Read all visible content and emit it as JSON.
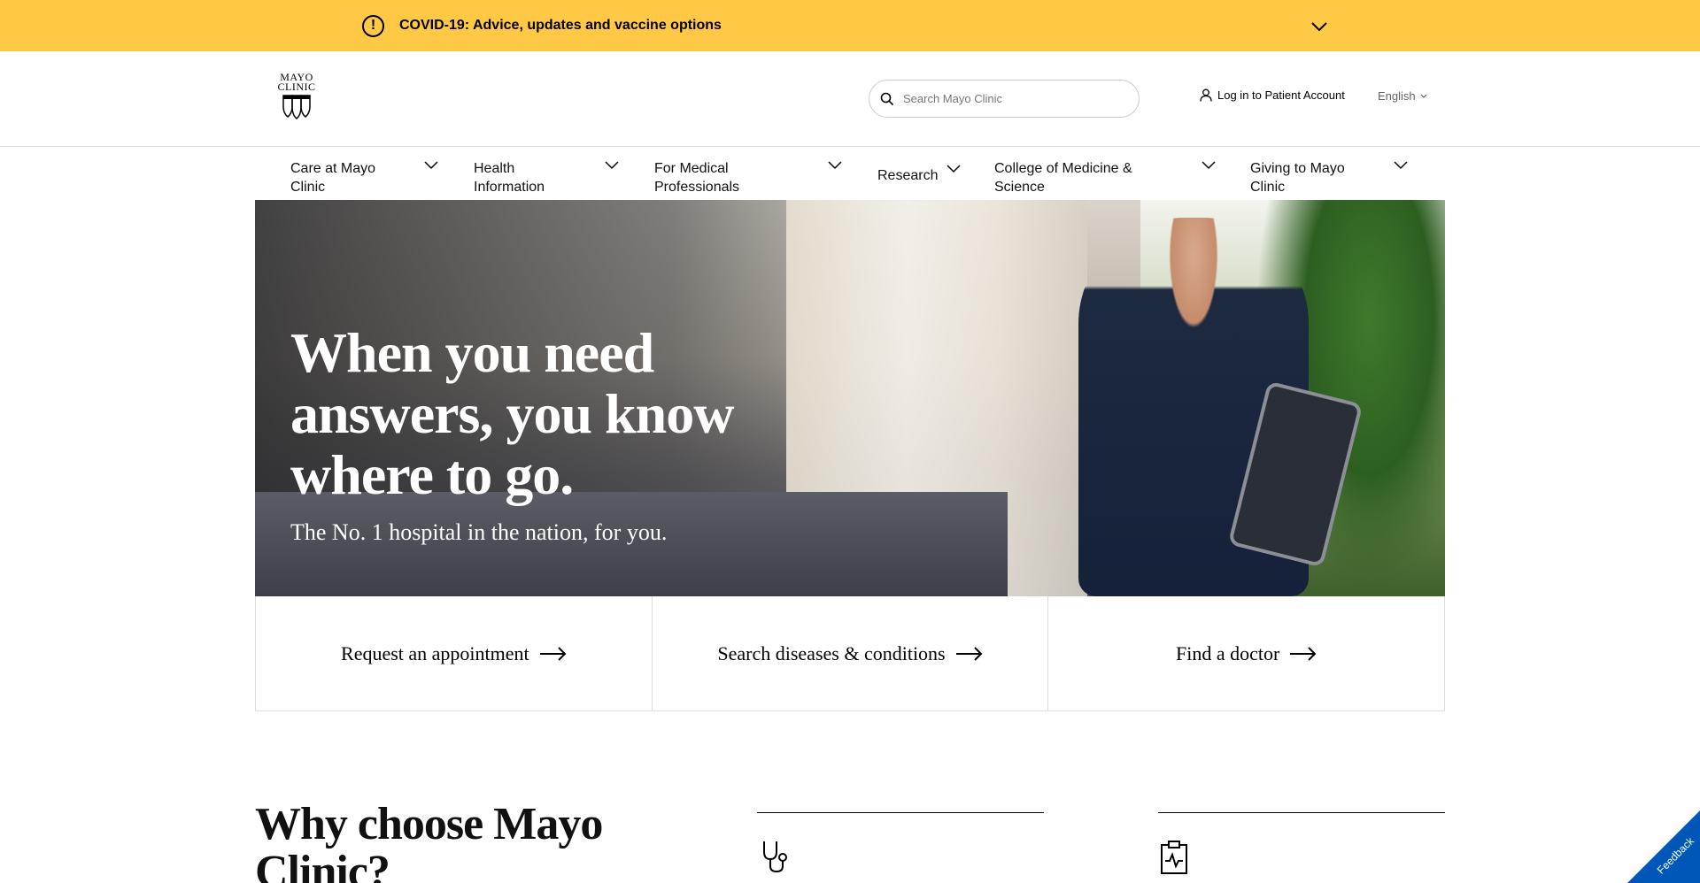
{
  "alert_bar": {
    "text": "COVID-19: Advice, updates and vaccine options",
    "icon": "alert-circle-icon",
    "color": "#ffc845"
  },
  "header": {
    "logo": {
      "line1": "MAYO",
      "line2": "CLINIC"
    },
    "search": {
      "placeholder": "Search Mayo Clinic"
    },
    "login": {
      "label": "Log in to Patient Account"
    },
    "language": {
      "selected": "English"
    }
  },
  "nav": {
    "items": [
      {
        "label": "Care at Mayo Clinic"
      },
      {
        "label": "Health Information"
      },
      {
        "label": "For Medical Professionals"
      },
      {
        "label": "Research"
      },
      {
        "label": "College of Medicine & Science"
      },
      {
        "label": "Giving to Mayo Clinic"
      }
    ]
  },
  "hero": {
    "heading": "When you need answers, you know where to go.",
    "subheading": "The No. 1 hospital in the nation, for you."
  },
  "quick_links": [
    {
      "label": "Request an appointment"
    },
    {
      "label": "Search diseases & conditions"
    },
    {
      "label": "Find a doctor"
    }
  ],
  "why": {
    "heading": "Why choose Mayo Clinic?",
    "columns": [
      {
        "icon": "stethoscope-icon"
      },
      {
        "icon": "clipboard-icon"
      }
    ]
  },
  "feedback": {
    "label": "Feedback",
    "color": "#0057b8"
  }
}
